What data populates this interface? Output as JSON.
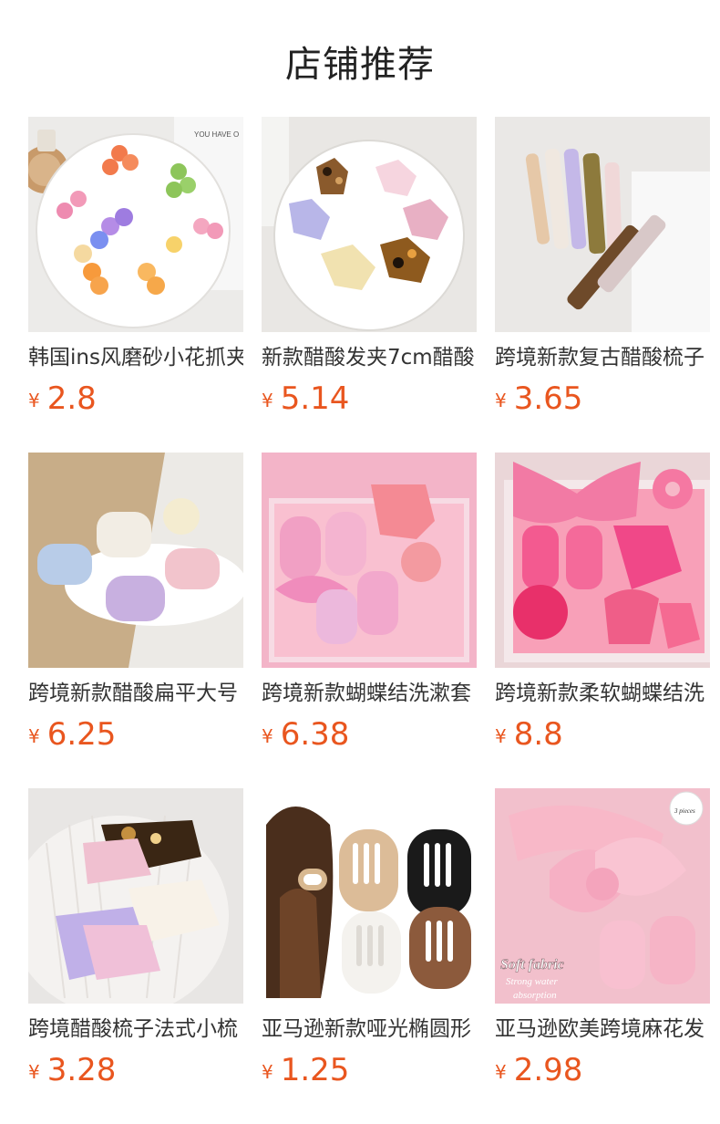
{
  "header": {
    "title": "店铺推荐"
  },
  "products": [
    {
      "name": "韩国ins风磨砂小花抓夹",
      "currency": "¥",
      "price": "2.8",
      "image_icon": "flower-claw-clips-image"
    },
    {
      "name": "新款醋酸发夹7cm醋酸",
      "currency": "¥",
      "price": "5.14",
      "image_icon": "acetate-butterfly-clips-image"
    },
    {
      "name": "跨境新款复古醋酸梳子",
      "currency": "¥",
      "price": "3.65",
      "image_icon": "acetate-combs-image"
    },
    {
      "name": "跨境新款醋酸扁平大号",
      "currency": "¥",
      "price": "6.25",
      "image_icon": "flat-acetate-clips-image"
    },
    {
      "name": "跨境新款蝴蝶结洗漱套",
      "currency": "¥",
      "price": "6.38",
      "image_icon": "pink-bow-wash-set-image"
    },
    {
      "name": "跨境新款柔软蝴蝶结洗",
      "currency": "¥",
      "price": "8.8",
      "image_icon": "hot-pink-wash-set-image"
    },
    {
      "name": "跨境醋酸梳子法式小梳",
      "currency": "¥",
      "price": "3.28",
      "image_icon": "french-combs-image"
    },
    {
      "name": "亚马逊新款哑光椭圆形",
      "currency": "¥",
      "price": "1.25",
      "image_icon": "matte-oval-clips-image"
    },
    {
      "name": "亚马逊欧美跨境麻花发",
      "currency": "¥",
      "price": "2.98",
      "image_icon": "bow-headband-image"
    }
  ],
  "image_text": {
    "notebook": "YOU HAVE O",
    "soft_fabric": "Soft fabric",
    "strong_water": "Strong water",
    "absorption": "absorption",
    "pieces": "3 pieces"
  },
  "colors": {
    "price": "#e9561f",
    "title": "#222222",
    "text": "#333333"
  }
}
